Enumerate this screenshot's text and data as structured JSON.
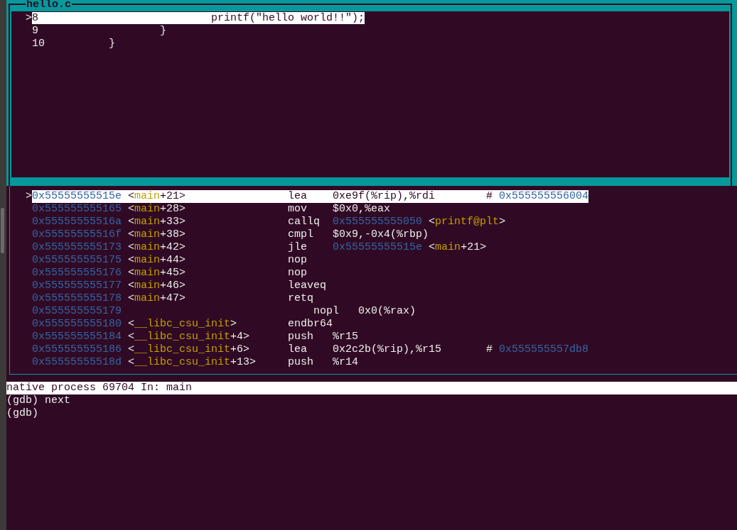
{
  "source_window": {
    "title": "hello.c",
    "lines": [
      {
        "marker": ">",
        "text": "8\t\t\t\tprintf(\"hello world!!\");",
        "selected": true
      },
      {
        "text": "9\t\t\t}",
        "selected": false
      },
      {
        "text": "10\t\t}",
        "selected": false
      }
    ]
  },
  "asm_window": {
    "rows": [
      {
        "marker": ">",
        "address": "0x55555555515e",
        "symbol": "<main+21>",
        "opcode": "lea",
        "operands": "0xe9f(%rip),%rdi",
        "comment": "# 0x555555556004",
        "selected": true
      },
      {
        "address": "0x555555555165",
        "symbol": "<main+28>",
        "opcode": "mov",
        "operands": "$0x0,%eax",
        "selected": false
      },
      {
        "address": "0x55555555516a",
        "symbol": "<main+33>",
        "opcode": "callq",
        "operands": "0x555555555050 <printf@plt>",
        "selected": false
      },
      {
        "address": "0x55555555516f",
        "symbol": "<main+38>",
        "opcode": "cmpl",
        "operands": "$0x9,-0x4(%rbp)",
        "selected": false
      },
      {
        "address": "0x555555555173",
        "symbol": "<main+42>",
        "opcode": "jle",
        "operands": "0x55555555515e <main+21>",
        "selected": false
      },
      {
        "address": "0x555555555175",
        "symbol": "<main+44>",
        "opcode": "nop",
        "selected": false
      },
      {
        "address": "0x555555555176",
        "symbol": "<main+45>",
        "opcode": "nop",
        "selected": false
      },
      {
        "address": "0x555555555177",
        "symbol": "<main+46>",
        "opcode": "leaveq",
        "selected": false
      },
      {
        "address": "0x555555555178",
        "symbol": "<main+47>",
        "opcode": "retq",
        "selected": false
      },
      {
        "address": "0x555555555179",
        "opcode": "nopl",
        "operands": "0x0(%rax)",
        "selected": false
      },
      {
        "address": "0x555555555180",
        "symbol": "<__libc_csu_init>",
        "opcode": "endbr64",
        "selected": false
      },
      {
        "address": "0x555555555184",
        "symbol": "<__libc_csu_init+4>",
        "opcode": "push",
        "operands": "%r15",
        "selected": false
      },
      {
        "address": "0x555555555186",
        "symbol": "<__libc_csu_init+6>",
        "opcode": "lea",
        "operands": "0x2c2b(%rip),%r15",
        "comment": "# 0x555555557db8",
        "selected": false
      },
      {
        "address": "0x55555555518d",
        "symbol": "<__libc_csu_init+13>",
        "opcode": "push",
        "operands": "%r14",
        "selected": false
      }
    ]
  },
  "status_bar": "native process 69704 In: main",
  "command_lines": [
    "(gdb) next",
    "(gdb)"
  ]
}
